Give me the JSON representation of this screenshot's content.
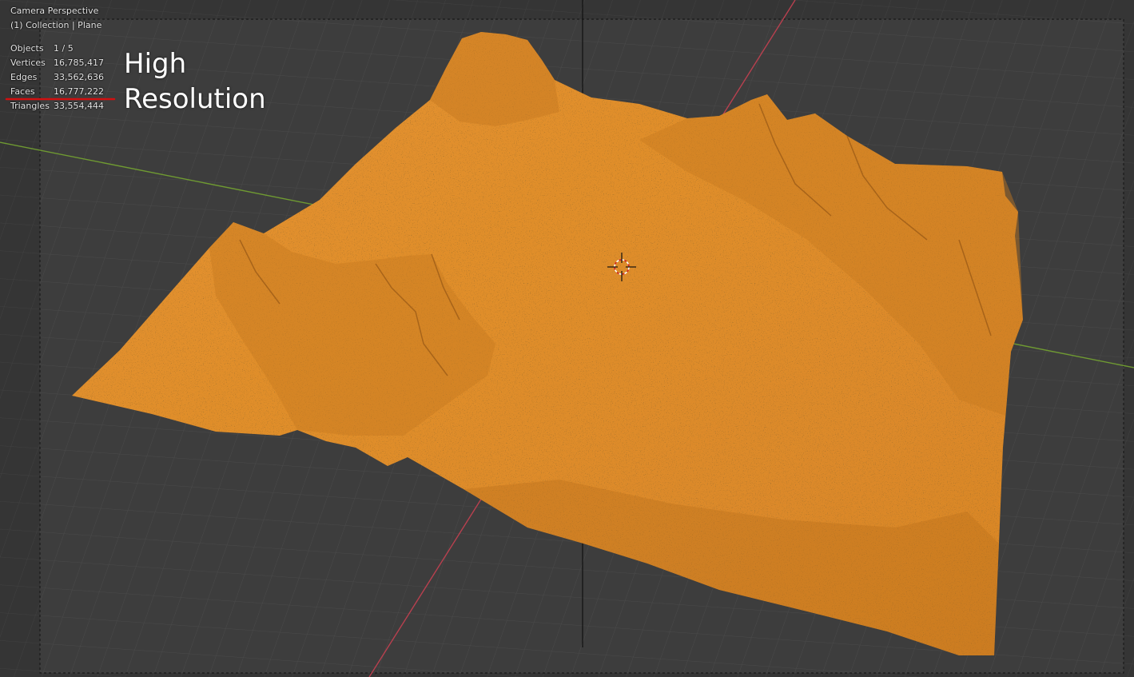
{
  "viewport": {
    "view_name": "Camera Perspective",
    "collection_label": "(1) Collection | Plane"
  },
  "stats": [
    {
      "label": "Objects",
      "value": "1 / 5"
    },
    {
      "label": "Vertices",
      "value": "16,785,417"
    },
    {
      "label": "Edges",
      "value": "33,562,636"
    },
    {
      "label": "Faces",
      "value": "16,777,222"
    },
    {
      "label": "Triangles",
      "value": "33,554,444"
    }
  ],
  "annotation": {
    "line1": "High",
    "line2": "Resolution"
  },
  "icons": [
    "3d-cursor-icon"
  ],
  "colors": {
    "background": "#3d3d3d",
    "grid": "#4a4a4a",
    "x_axis": "#b8404f",
    "y_axis": "#6f9a32",
    "terrain": "#e08e2d",
    "terrain_shadow": "#a4621c",
    "faces_underline": "#d11010"
  }
}
